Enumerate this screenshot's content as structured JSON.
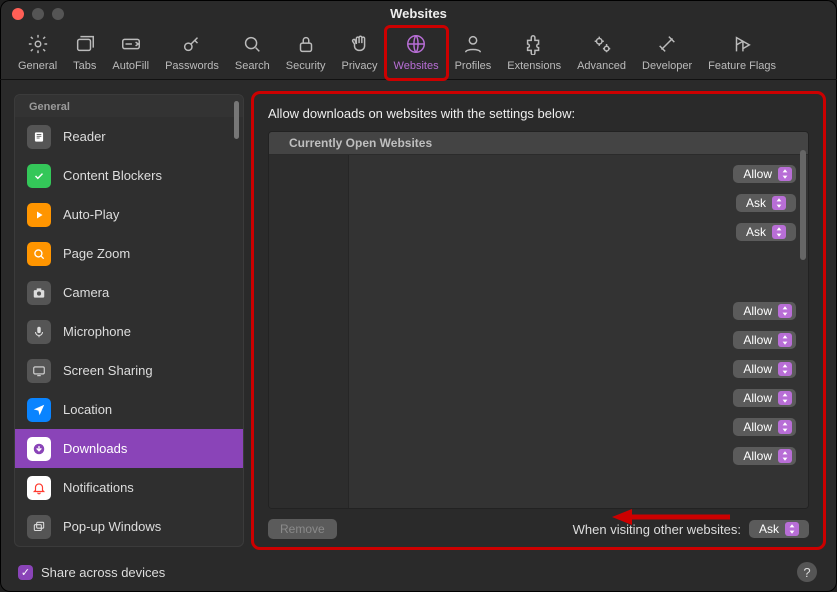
{
  "window": {
    "title": "Websites"
  },
  "toolbar": {
    "items": [
      {
        "label": "General"
      },
      {
        "label": "Tabs"
      },
      {
        "label": "AutoFill"
      },
      {
        "label": "Passwords"
      },
      {
        "label": "Search"
      },
      {
        "label": "Security"
      },
      {
        "label": "Privacy"
      },
      {
        "label": "Websites"
      },
      {
        "label": "Profiles"
      },
      {
        "label": "Extensions"
      },
      {
        "label": "Advanced"
      },
      {
        "label": "Developer"
      },
      {
        "label": "Feature Flags"
      }
    ]
  },
  "sidebar": {
    "group_label": "General",
    "items": [
      {
        "label": "Reader"
      },
      {
        "label": "Content Blockers"
      },
      {
        "label": "Auto-Play"
      },
      {
        "label": "Page Zoom"
      },
      {
        "label": "Camera"
      },
      {
        "label": "Microphone"
      },
      {
        "label": "Screen Sharing"
      },
      {
        "label": "Location"
      },
      {
        "label": "Downloads"
      },
      {
        "label": "Notifications"
      },
      {
        "label": "Pop-up Windows"
      }
    ],
    "selected_index": 8
  },
  "main": {
    "heading": "Allow downloads on websites with the settings below:",
    "list_header": "Currently Open Websites",
    "rows": [
      {
        "value": "Allow"
      },
      {
        "value": "Ask"
      },
      {
        "value": "Ask"
      },
      {
        "value": "Allow"
      },
      {
        "value": "Allow"
      },
      {
        "value": "Allow"
      },
      {
        "value": "Allow"
      },
      {
        "value": "Allow"
      },
      {
        "value": "Allow"
      }
    ],
    "remove_label": "Remove",
    "other_websites_label": "When visiting other websites:",
    "other_websites_value": "Ask"
  },
  "bottom": {
    "share_label": "Share across devices",
    "share_checked": true
  }
}
